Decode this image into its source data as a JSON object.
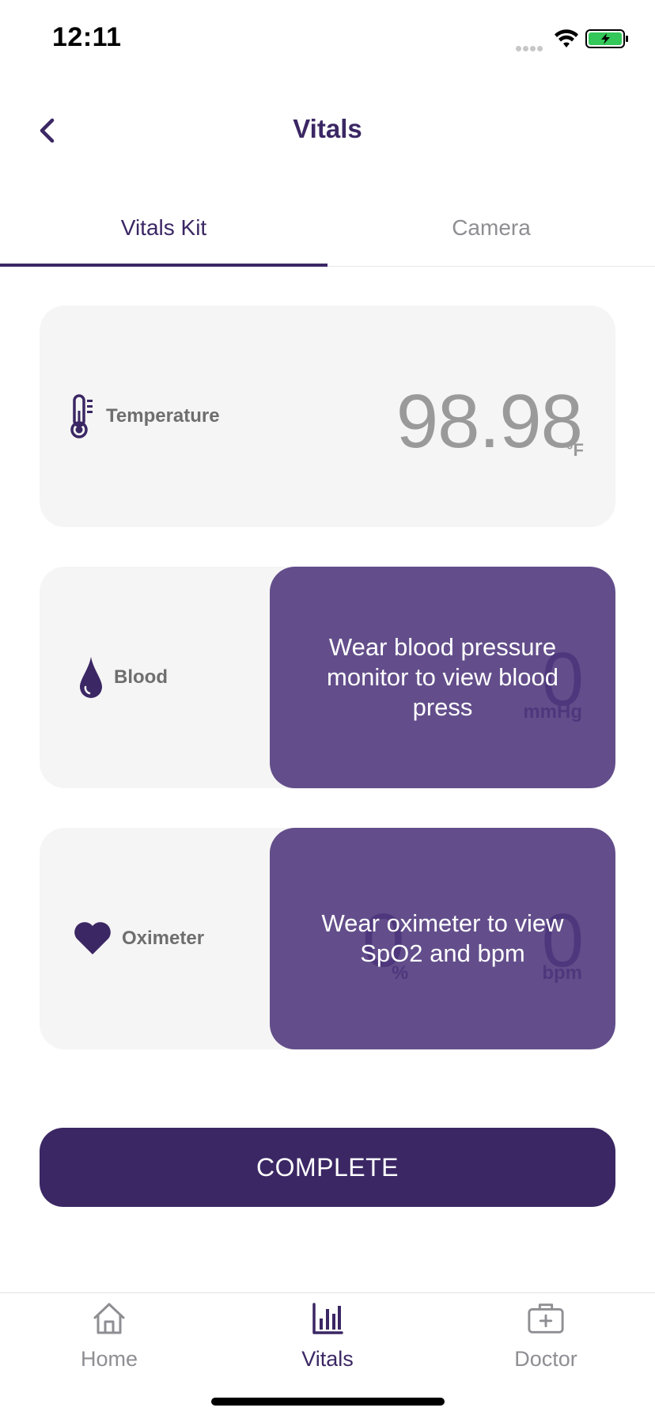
{
  "status_bar": {
    "time": "12:11"
  },
  "header": {
    "title": "Vitals"
  },
  "tabs": [
    {
      "label": "Vitals Kit",
      "active": true
    },
    {
      "label": "Camera",
      "active": false
    }
  ],
  "cards": {
    "temperature": {
      "label": "Temperature",
      "value": "98.98",
      "unit": "°F",
      "icon": "thermometer-icon"
    },
    "blood": {
      "label": "Blood",
      "value": "0",
      "unit": "mmHg",
      "overlay": "Wear blood pressure monitor to view blood press",
      "icon": "blood-drop-icon"
    },
    "oximeter": {
      "label": "Oximeter",
      "spo2_value": "0",
      "spo2_unit": "%",
      "bpm_value": "0",
      "bpm_unit": "bpm",
      "overlay": "Wear oximeter to view SpO2 and bpm",
      "icon": "heart-icon"
    }
  },
  "complete_button": {
    "label": "COMPLETE"
  },
  "bottom_nav": [
    {
      "label": "Home",
      "icon": "home-icon",
      "active": false
    },
    {
      "label": "Vitals",
      "icon": "bar-chart-icon",
      "active": true
    },
    {
      "label": "Doctor",
      "icon": "medical-kit-icon",
      "active": false
    }
  ],
  "colors": {
    "primary": "#3b2764",
    "overlay": "#4e377c",
    "card_bg": "#f5f5f5",
    "inactive": "#8e8e93",
    "battery": "#34c759"
  }
}
